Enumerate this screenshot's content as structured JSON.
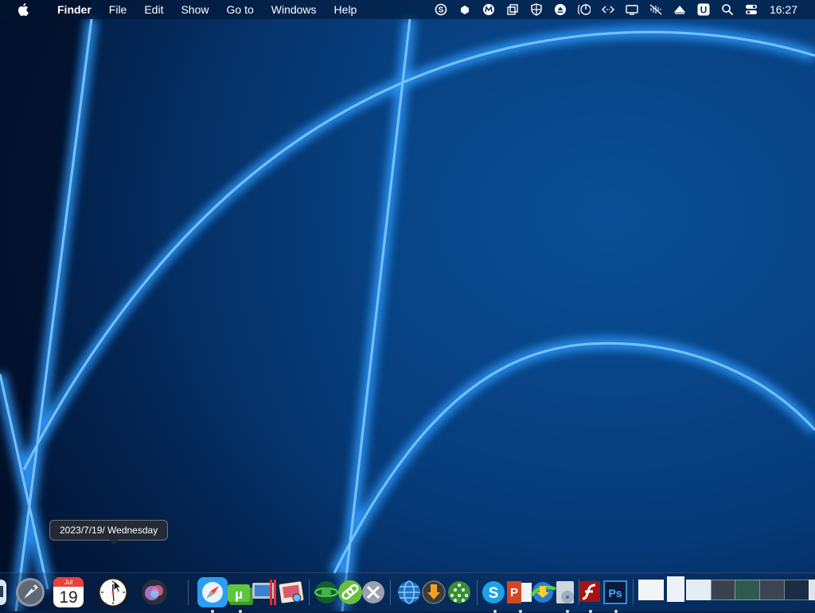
{
  "menubar": {
    "app_name": "Finder",
    "menus": [
      "File",
      "Edit",
      "Show",
      "Go to",
      "Windows",
      "Help"
    ],
    "status_icons": [
      "skype-icon",
      "cloud-box-icon",
      "malwarebytes-icon",
      "stack-icon",
      "shield-icon",
      "eject-icon",
      "power-icon",
      "code-icon",
      "display-icon",
      "mute-icon",
      "upload-icon",
      "u-badge-icon",
      "search-icon",
      "control-center-icon"
    ],
    "clock": "16:27"
  },
  "tooltip": {
    "text": "2023/7/19/ Wednesday"
  },
  "dock": {
    "calendar": {
      "month": "Jul",
      "day": "19"
    }
  }
}
